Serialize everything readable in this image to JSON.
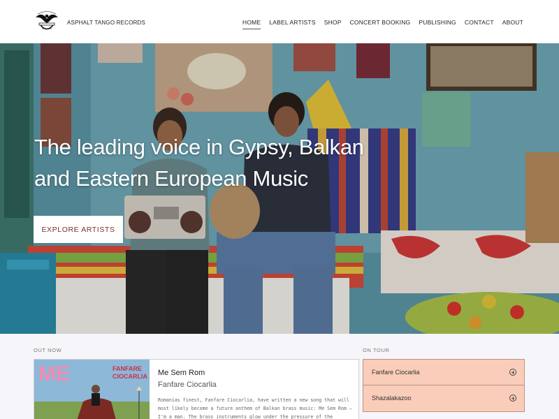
{
  "header": {
    "brand": "ASPHALT TANGO RECORDS",
    "logo_icon": "eagle-logo-icon",
    "nav": [
      {
        "label": "HOME",
        "active": true
      },
      {
        "label": "LABEL ARTISTS"
      },
      {
        "label": "SHOP"
      },
      {
        "label": "CONCERT BOOKING"
      },
      {
        "label": "PUBLISHING"
      },
      {
        "label": "CONTACT"
      },
      {
        "label": "ABOUT"
      }
    ]
  },
  "hero": {
    "title": "The leading voice in Gypsy, Balkan and Eastern European Music",
    "button_label": "EXPLORE ARTISTS"
  },
  "out_now": {
    "section_label": "OUT NOW",
    "cover_text": "FANFARE CIOCARLIA",
    "cover_big": "ME",
    "title": "Me Sem Rom",
    "artist": "Fanfare Ciocarlia",
    "description": "Romanias finest, Fanfare Ciocarlia, have written a new song that will most likely become a future anthem of Balkan brass music: Me Sem Rom – I'm a man. The brass instruments glow under the pressure of the melody,"
  },
  "on_tour": {
    "section_label": "ON TOUR",
    "items": [
      {
        "name": "Fanfare Ciocarlia"
      },
      {
        "name": "Shazalakazoo"
      }
    ]
  },
  "colors": {
    "accent_button_text": "#7b2d2a",
    "tour_bg": "#f9cdb9",
    "section_bg": "#f6f5f9"
  }
}
